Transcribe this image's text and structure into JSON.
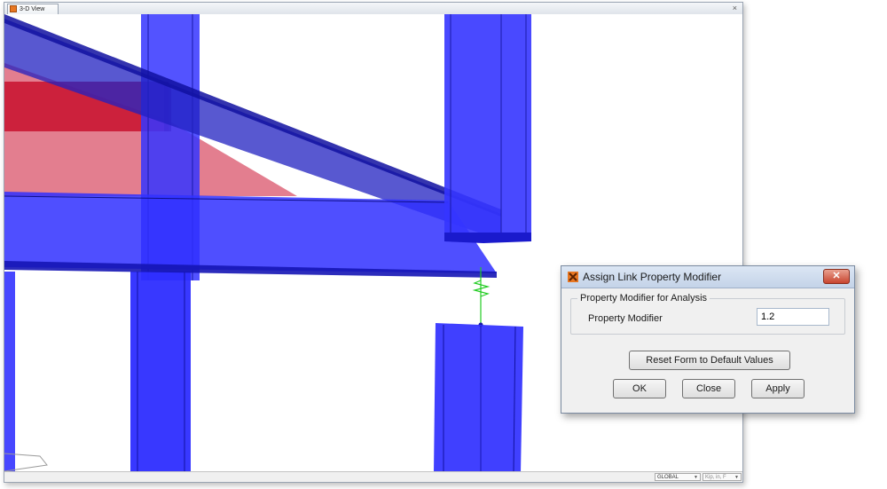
{
  "app": {
    "view_tab_label": "3-D View",
    "view_close": "×"
  },
  "status_bar": {
    "coord_system": "GLOBAL",
    "units": "Kip, in, F"
  },
  "dialog": {
    "title": "Assign Link Property Modifier",
    "close_glyph": "✕",
    "group_title": "Property Modifier for Analysis",
    "field_label": "Property Modifier",
    "field_value": "1.2",
    "reset_button": "Reset Form to Default Values",
    "ok_button": "OK",
    "close_button": "Close",
    "apply_button": "Apply"
  },
  "colors": {
    "steel_blue": "#2a2aff",
    "beam_red": "#c8102e",
    "link_green": "#22cc22",
    "app_icon_orange": "#e87722"
  }
}
